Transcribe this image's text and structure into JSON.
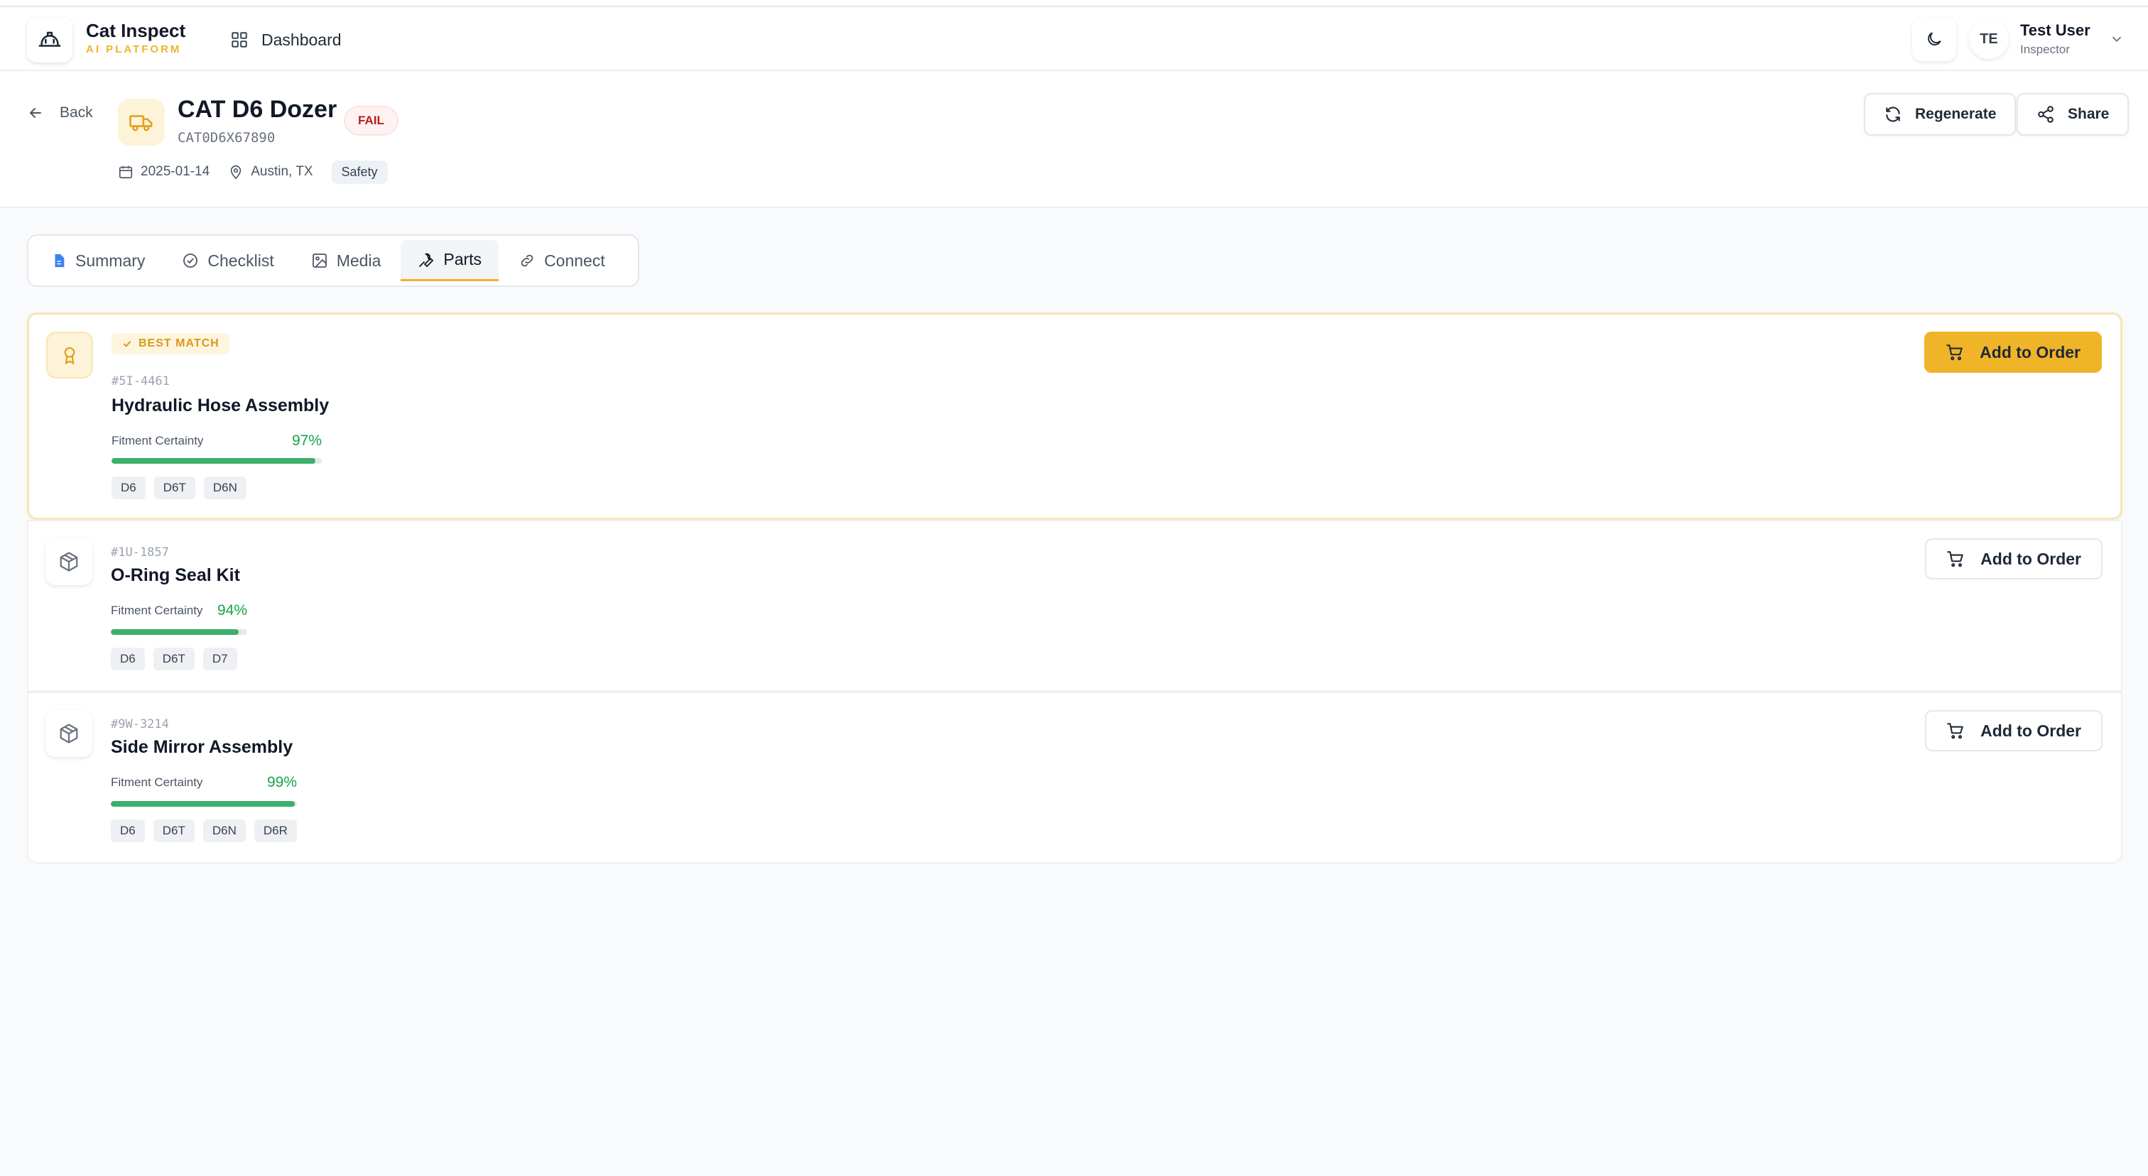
{
  "app": {
    "brand": "Cat Inspect",
    "brand_sub": "AI PLATFORM",
    "dashboard": "Dashboard",
    "user": {
      "initials": "TE",
      "name": "Test User",
      "role": "Inspector"
    }
  },
  "inspection": {
    "back": "Back",
    "title": "CAT D6 Dozer",
    "status": "FAIL",
    "serial": "CAT0D6X67890",
    "date": "2025-01-14",
    "location": "Austin, TX",
    "category": "Safety",
    "actions": {
      "regenerate": "Regenerate",
      "share": "Share"
    }
  },
  "tabs": [
    {
      "label": "Summary"
    },
    {
      "label": "Checklist"
    },
    {
      "label": "Media"
    },
    {
      "label": "Parts"
    },
    {
      "label": "Connect"
    }
  ],
  "active_tab": "Parts",
  "parts": [
    {
      "badge": "BEST MATCH",
      "number": "#5I-4461",
      "name": "Hydraulic Hose Assembly",
      "fit_label": "Fitment Certainty",
      "fit_value": "97%",
      "fit_fraction": 0.97,
      "models": [
        "D6",
        "D6T",
        "D6N"
      ],
      "button": "Add to Order"
    },
    {
      "number": "#1U-1857",
      "name": "O-Ring Seal Kit",
      "fit_label": "Fitment Certainty",
      "fit_value": "94%",
      "fit_fraction": 0.94,
      "models": [
        "D6",
        "D6T",
        "D7"
      ],
      "button": "Add to Order"
    },
    {
      "number": "#9W-3214",
      "name": "Side Mirror Assembly",
      "fit_label": "Fitment Certainty",
      "fit_value": "99%",
      "fit_fraction": 0.99,
      "models": [
        "D6",
        "D6T",
        "D6N",
        "D6R"
      ],
      "button": "Add to Order"
    }
  ],
  "colors": {
    "accent": "#f0b429",
    "fail": "#b91c1c",
    "fit": "#3dae6b",
    "fit_text": "#16a34a"
  }
}
